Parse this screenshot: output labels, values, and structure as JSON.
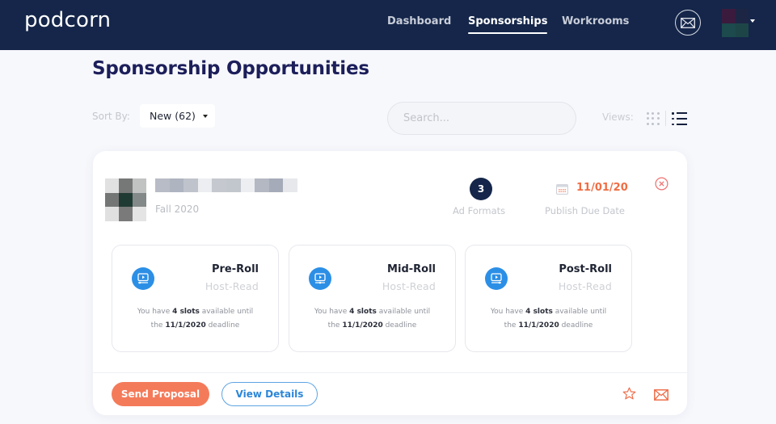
{
  "nav": {
    "logo": "podcorn",
    "links": [
      {
        "label": "Dashboard",
        "active": false
      },
      {
        "label": "Sponsorships",
        "active": true
      },
      {
        "label": "Workrooms",
        "active": false
      }
    ],
    "mail_icon": "envelope-icon",
    "avatar_menu_icon": "caret-down-icon"
  },
  "page": {
    "title": "Sponsorship Opportunities"
  },
  "toolbar": {
    "sort_label": "Sort By:",
    "sort_value": "New (62)",
    "search_placeholder": "Search...",
    "views_label": "Views:",
    "views": [
      "grid-view-icon",
      "list-view-icon"
    ],
    "active_view": "list"
  },
  "opportunity": {
    "season": "Fall 2020",
    "ad_formats_count": "3",
    "ad_formats_label": "Ad Formats",
    "publish_due_date": "11/01/20",
    "publish_due_label": "Publish Due Date",
    "slots": [
      {
        "name": "Pre-Roll",
        "type": "Host-Read",
        "desc_pre": "You have ",
        "slots": "4 slots",
        "desc_mid": " available until",
        "desc_the": "the ",
        "deadline": "11/1/2020",
        "desc_post": " deadline"
      },
      {
        "name": "Mid-Roll",
        "type": "Host-Read",
        "desc_pre": "You have ",
        "slots": "4 slots",
        "desc_mid": " available until",
        "desc_the": "the ",
        "deadline": "11/1/2020",
        "desc_post": " deadline"
      },
      {
        "name": "Post-Roll",
        "type": "Host-Read",
        "desc_pre": "You have ",
        "slots": "4 slots",
        "desc_mid": " available until",
        "desc_the": "the ",
        "deadline": "11/1/2020",
        "desc_post": " deadline"
      }
    ],
    "actions": {
      "send_proposal": "Send Proposal",
      "view_details": "View Details"
    }
  },
  "colors": {
    "nav_bg": "#15264a",
    "accent_orange": "#f47b5a",
    "accent_blue": "#2c8fe6",
    "title_navy": "#1c1f5a"
  }
}
